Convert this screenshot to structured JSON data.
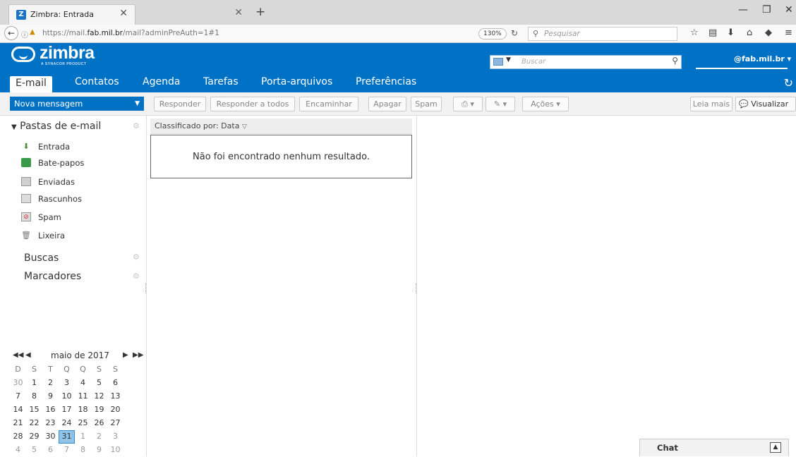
{
  "browser": {
    "tab_title": "Zimbra: Entrada",
    "tab_favicon_letter": "Z",
    "url_prefix": "https://mail.",
    "url_domain": "fab.mil.br",
    "url_suffix": "/mail?adminPreAuth=1#1",
    "zoom": "130%",
    "search_placeholder": "Pesquisar"
  },
  "header": {
    "logo_text": "zimbra",
    "logo_sub": "A SYNACOR PRODUCT",
    "search_placeholder": "Buscar",
    "user": "@fab.mil.br"
  },
  "app_tabs": [
    "E-mail",
    "Contatos",
    "Agenda",
    "Tarefas",
    "Porta-arquivos",
    "Preferências"
  ],
  "toolbar": {
    "new_message": "Nova mensagem",
    "reply": "Responder",
    "reply_all": "Responder a todos",
    "forward": "Encaminhar",
    "delete": "Apagar",
    "spam": "Spam",
    "actions": "Ações",
    "read_more": "Leia mais",
    "view": "Visualizar"
  },
  "sidebar": {
    "folders_header": "Pastas de e-mail",
    "folders": [
      {
        "label": "Entrada",
        "icon": "inbox-icon"
      },
      {
        "label": "Bate-papos",
        "icon": "chats-icon"
      },
      {
        "label": "Enviadas",
        "icon": "sent-icon"
      },
      {
        "label": "Rascunhos",
        "icon": "drafts-icon"
      },
      {
        "label": "Spam",
        "icon": "spam-icon"
      },
      {
        "label": "Lixeira",
        "icon": "trash-icon"
      }
    ],
    "searches_header": "Buscas",
    "tags_header": "Marcadores"
  },
  "calendar": {
    "title": "maio de 2017",
    "weekdays": [
      "D",
      "S",
      "T",
      "Q",
      "Q",
      "S",
      "S"
    ],
    "weeks": [
      [
        "30",
        "1",
        "2",
        "3",
        "4",
        "5",
        "6"
      ],
      [
        "7",
        "8",
        "9",
        "10",
        "11",
        "12",
        "13"
      ],
      [
        "14",
        "15",
        "16",
        "17",
        "18",
        "19",
        "20"
      ],
      [
        "21",
        "22",
        "23",
        "24",
        "25",
        "26",
        "27"
      ],
      [
        "28",
        "29",
        "30",
        "31",
        "1",
        "2",
        "3"
      ],
      [
        "4",
        "5",
        "6",
        "7",
        "8",
        "9",
        "10"
      ]
    ],
    "today": "31"
  },
  "list": {
    "sort_label": "Classificado por: Data",
    "empty_message": "Não foi encontrado nenhum resultado."
  },
  "chat": {
    "label": "Chat"
  }
}
